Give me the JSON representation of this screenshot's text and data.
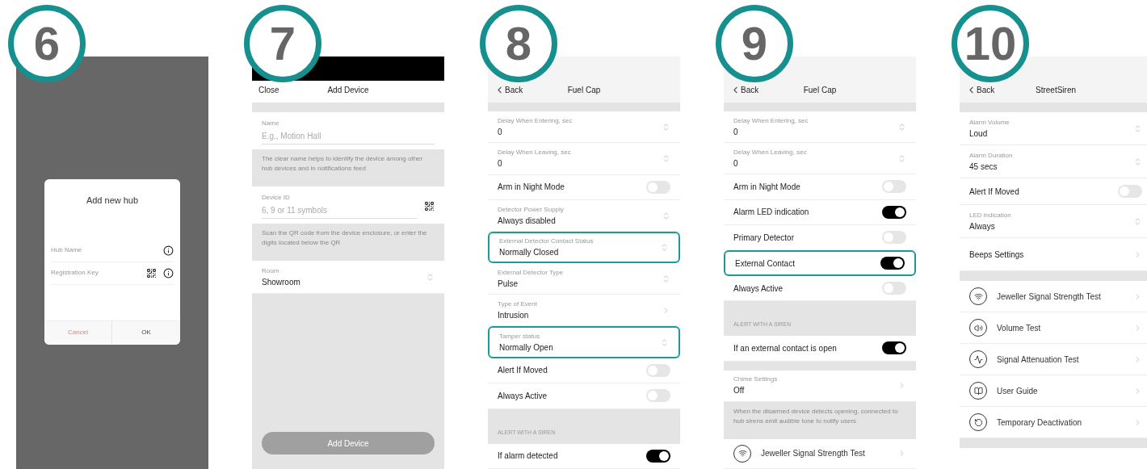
{
  "steps": [
    {
      "number": "6",
      "kind": "dialog",
      "dialog": {
        "title": "Add new hub",
        "fields": [
          {
            "placeholder": "Hub Name",
            "qr": false
          },
          {
            "placeholder": "Registration Key",
            "qr": true
          }
        ],
        "buttons": [
          {
            "label": "Cancel",
            "kind": "cancel"
          },
          {
            "label": "OK",
            "kind": "ok"
          }
        ]
      }
    },
    {
      "number": "7",
      "kind": "form",
      "header": {
        "left": "Close",
        "title": "Add Device"
      },
      "items": [
        {
          "kind": "spacer"
        },
        {
          "kind": "input",
          "label": "Name",
          "placeholder": "E.g., Motion Hall",
          "qr": false
        },
        {
          "kind": "note",
          "text": "The clear name helps to identify the device among other hub devices and in notifications feed"
        },
        {
          "kind": "input",
          "label": "Device ID",
          "placeholder": "6, 9 or 11 symbols",
          "qr": true
        },
        {
          "kind": "note",
          "text": "Scan the QR code from the device enclosure, or enter the digits located below the QR"
        },
        {
          "kind": "select",
          "label": "Room",
          "value": "Showroom",
          "highlighted": false
        }
      ],
      "button": {
        "label": "Add Device",
        "disabled": true
      }
    },
    {
      "number": "8",
      "kind": "settings",
      "header": {
        "left": "Back",
        "title": "Fuel Cap"
      },
      "items": [
        {
          "kind": "spacer"
        },
        {
          "kind": "select",
          "label": "Delay When Entering, sec",
          "value": "0",
          "highlighted": false
        },
        {
          "kind": "select",
          "label": "Delay When Leaving, sec",
          "value": "0",
          "highlighted": false
        },
        {
          "kind": "toggle",
          "label": "Arm in Night Mode",
          "on": false,
          "highlighted": false
        },
        {
          "kind": "select",
          "label": "Detector Power Supply",
          "value": "Always disabled",
          "highlighted": false
        },
        {
          "kind": "select",
          "label": "External Detector Contact Status",
          "value": "Normally Closed",
          "highlighted": true
        },
        {
          "kind": "select",
          "label": "External Detector Type",
          "value": "Pulse",
          "highlighted": false
        },
        {
          "kind": "link",
          "label": "Type of Event",
          "value": "Intrusion",
          "highlighted": false
        },
        {
          "kind": "select",
          "label": "Tamper status",
          "value": "Normally Open",
          "highlighted": true
        },
        {
          "kind": "toggle",
          "label": "Alert If Moved",
          "on": false,
          "highlighted": false
        },
        {
          "kind": "toggle",
          "label": "Always Active",
          "on": false,
          "highlighted": false
        },
        {
          "kind": "section",
          "text": "ALERT WITH A SIREN"
        },
        {
          "kind": "toggle",
          "label": "If alarm detected",
          "on": true,
          "highlighted": false
        }
      ]
    },
    {
      "number": "9",
      "kind": "settings",
      "header": {
        "left": "Back",
        "title": "Fuel Cap"
      },
      "items": [
        {
          "kind": "spacer"
        },
        {
          "kind": "select",
          "label": "Delay When Entering, sec",
          "value": "0",
          "highlighted": false
        },
        {
          "kind": "select",
          "label": "Delay When Leaving, sec",
          "value": "0",
          "highlighted": false
        },
        {
          "kind": "toggle",
          "label": "Arm in Night Mode",
          "on": false,
          "highlighted": false
        },
        {
          "kind": "toggle",
          "label": "Alarm LED indication",
          "on": true,
          "highlighted": false
        },
        {
          "kind": "toggle",
          "label": "Primary Detector",
          "on": false,
          "highlighted": false
        },
        {
          "kind": "toggle",
          "label": "External Contact",
          "on": true,
          "highlighted": true
        },
        {
          "kind": "toggle",
          "label": "Always Active",
          "on": false,
          "highlighted": false
        },
        {
          "kind": "section",
          "text": "ALERT WITH A SIREN"
        },
        {
          "kind": "toggle",
          "label": "If an external contact is open",
          "on": true,
          "highlighted": false
        },
        {
          "kind": "spacer"
        },
        {
          "kind": "link",
          "label": "Chime Settings",
          "value": "Off",
          "highlighted": false
        },
        {
          "kind": "note",
          "text": "When the disarmed device detects opening, connected to hub sirens emit audible tone to notify users"
        },
        {
          "kind": "action",
          "label": "Jeweller Signal Strength Test"
        }
      ]
    },
    {
      "number": "10",
      "kind": "settings",
      "header": {
        "left": "Back",
        "title": "StreetSiren"
      },
      "items": [
        {
          "kind": "spacer"
        },
        {
          "kind": "select",
          "label": "Alarm Volume",
          "value": "Loud",
          "highlighted": false
        },
        {
          "kind": "select",
          "label": "Alarm Duration",
          "value": "45 secs",
          "highlighted": false
        },
        {
          "kind": "toggle",
          "label": "Alert If Moved",
          "on": false,
          "highlighted": false
        },
        {
          "kind": "select",
          "label": "LED indication",
          "value": "Always",
          "highlighted": false
        },
        {
          "kind": "link",
          "label": "Beeps Settings",
          "highlighted": false
        },
        {
          "kind": "spacer"
        },
        {
          "kind": "action",
          "label": "Jeweller Signal Strength Test"
        },
        {
          "kind": "action",
          "label": "Volume Test"
        },
        {
          "kind": "action",
          "label": "Signal Attenuation Test"
        },
        {
          "kind": "action",
          "label": "User Guide"
        },
        {
          "kind": "action",
          "label": "Temporary Deactivation"
        },
        {
          "kind": "spacer"
        }
      ]
    }
  ]
}
